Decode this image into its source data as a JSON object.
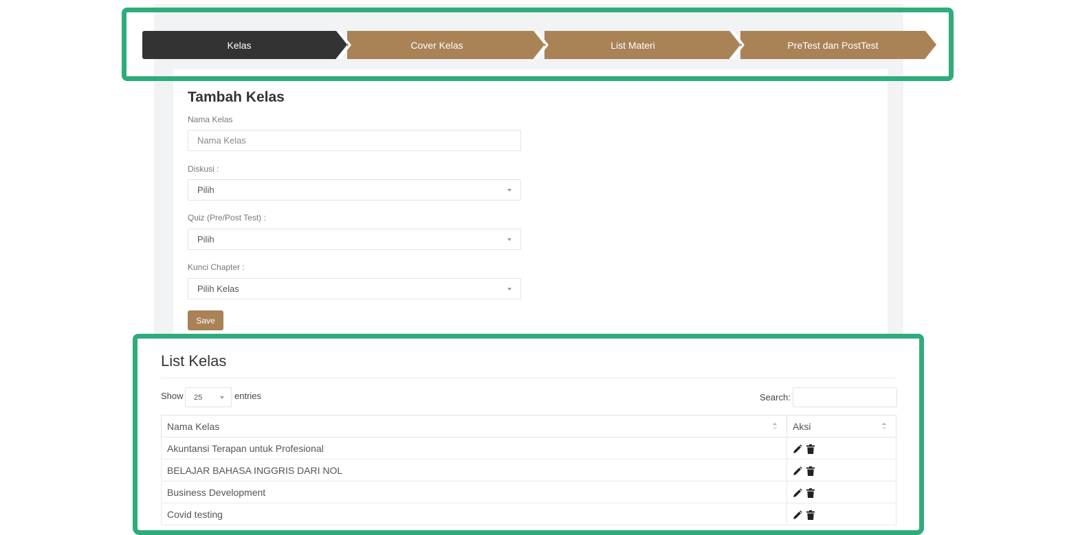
{
  "wizard": {
    "steps": [
      {
        "label": "Kelas",
        "state": "active"
      },
      {
        "label": "Cover Kelas",
        "state": "pending"
      },
      {
        "label": "List Materi",
        "state": "pending"
      },
      {
        "label": "PreTest dan PostTest",
        "state": "pending"
      }
    ]
  },
  "form": {
    "title": "Tambah Kelas",
    "nama_kelas": {
      "label": "Nama Kelas",
      "placeholder": "Nama Kelas"
    },
    "diskusi": {
      "label": "Diskusi :",
      "value": "Pilih"
    },
    "quiz": {
      "label": "Quiz (Pre/Post Test) :",
      "value": "Pilih"
    },
    "kunci": {
      "label": "Kunci Chapter :",
      "value": "Pilih Kelas"
    },
    "save_label": "Save"
  },
  "list": {
    "title": "List Kelas",
    "show_label": "Show",
    "entries_value": "25",
    "entries_label": "entries",
    "search_label": "Search:",
    "columns": [
      "Nama Kelas",
      "Aksi"
    ],
    "rows": [
      {
        "name": "Akuntansi Terapan untuk Profesional"
      },
      {
        "name": "BELAJAR BAHASA INGGRIS DARI NOL"
      },
      {
        "name": "Business Development"
      },
      {
        "name": "Covid testing"
      }
    ]
  },
  "colors": {
    "accent": "#a98256",
    "active_step": "#333333",
    "highlight": "#2fac7b"
  },
  "icons": [
    "pencil-icon",
    "trash-icon",
    "sort-icon",
    "chevron-down-icon"
  ]
}
